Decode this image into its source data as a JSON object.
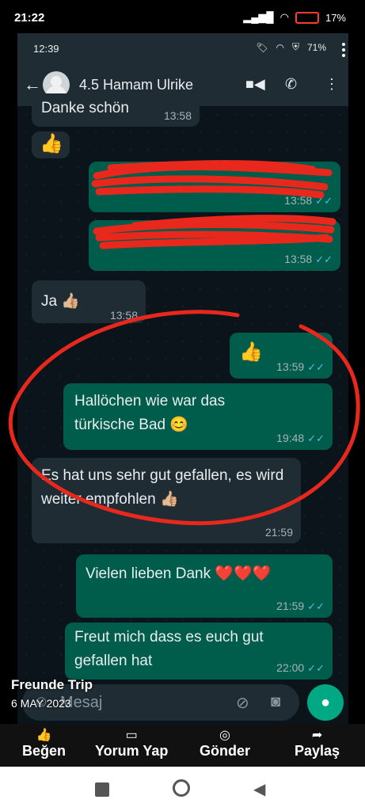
{
  "status": {
    "time": "21:22",
    "battery": "17%"
  },
  "screenshot": {
    "status": {
      "time": "12:39",
      "battery": "71%"
    },
    "contact_name": "4.5 Hamam Ulrike",
    "messages": [
      {
        "dir": "in",
        "text": "Danke schön",
        "time": "13:58"
      },
      {
        "dir": "in",
        "text": "👍",
        "time": ""
      },
      {
        "dir": "out",
        "text": "",
        "time": "13:58"
      },
      {
        "dir": "out",
        "text": "",
        "time": "13:58"
      },
      {
        "dir": "in",
        "text": "Ja 👍🏼",
        "time": "13:58"
      },
      {
        "dir": "out",
        "text": "👍",
        "time": "13:59"
      },
      {
        "dir": "out",
        "text": "Hallöchen wie war das türkische Bad 😊",
        "time": "19:48"
      },
      {
        "dir": "in",
        "text": "Es hat uns sehr gut gefallen, es wird weiter empfohlen 👍🏼",
        "time": "21:59"
      },
      {
        "dir": "out",
        "text": "Vielen lieben Dank ❤️❤️❤️",
        "time": "21:59"
      },
      {
        "dir": "out",
        "text": "Freut mich dass es euch gut gefallen hat",
        "time": "22:00"
      }
    ],
    "input_placeholder": "Mesaj"
  },
  "caption": {
    "title": "Freunde Trip",
    "date": "6 MAY 2023"
  },
  "actions": {
    "like": "Beğen",
    "comment": "Yorum Yap",
    "send": "Gönder",
    "share": "Paylaş"
  },
  "colors": {
    "annotation": "#e8281c",
    "outgoing": "#005c4b",
    "incoming": "#1f2c34",
    "accent": "#00a884"
  }
}
